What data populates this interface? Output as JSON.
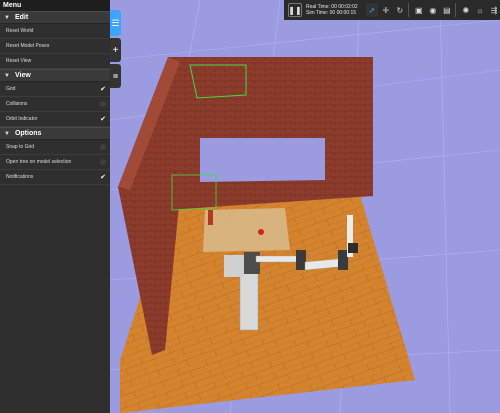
{
  "menu": {
    "title": "Menu",
    "sections": [
      {
        "label": "Edit",
        "items": [
          {
            "label": "Reset World"
          },
          {
            "label": "Reset Model Poses"
          },
          {
            "label": "Reset View"
          }
        ]
      },
      {
        "label": "View",
        "items": [
          {
            "label": "Grid",
            "state": "checked"
          },
          {
            "label": "Collisions",
            "state": "unchecked"
          },
          {
            "label": "Orbit Indicator",
            "state": "checked"
          }
        ]
      },
      {
        "label": "Options",
        "items": [
          {
            "label": "Snap to Grid",
            "state": "unchecked"
          },
          {
            "label": "Open tree on model selection",
            "state": "unchecked"
          },
          {
            "label": "Notifications",
            "state": "checked"
          }
        ]
      }
    ]
  },
  "toolbar": {
    "real_time": "Real Time: 00 00:02:02",
    "sim_time": "Sim Time: 00 00:00:15",
    "icons": [
      "pause-icon",
      "select-arrow-icon",
      "translate-icon",
      "rotate-icon",
      "box-shape-icon",
      "sphere-shape-icon",
      "cylinder-shape-icon",
      "point-light-icon",
      "spot-light-icon",
      "directional-light-icon"
    ]
  },
  "colors": {
    "background": "#9a9be0",
    "sidebar": "#2f2f2f",
    "accent": "#3fa4ff",
    "brick": "#8d3c2c",
    "floor": "#d4842e"
  }
}
